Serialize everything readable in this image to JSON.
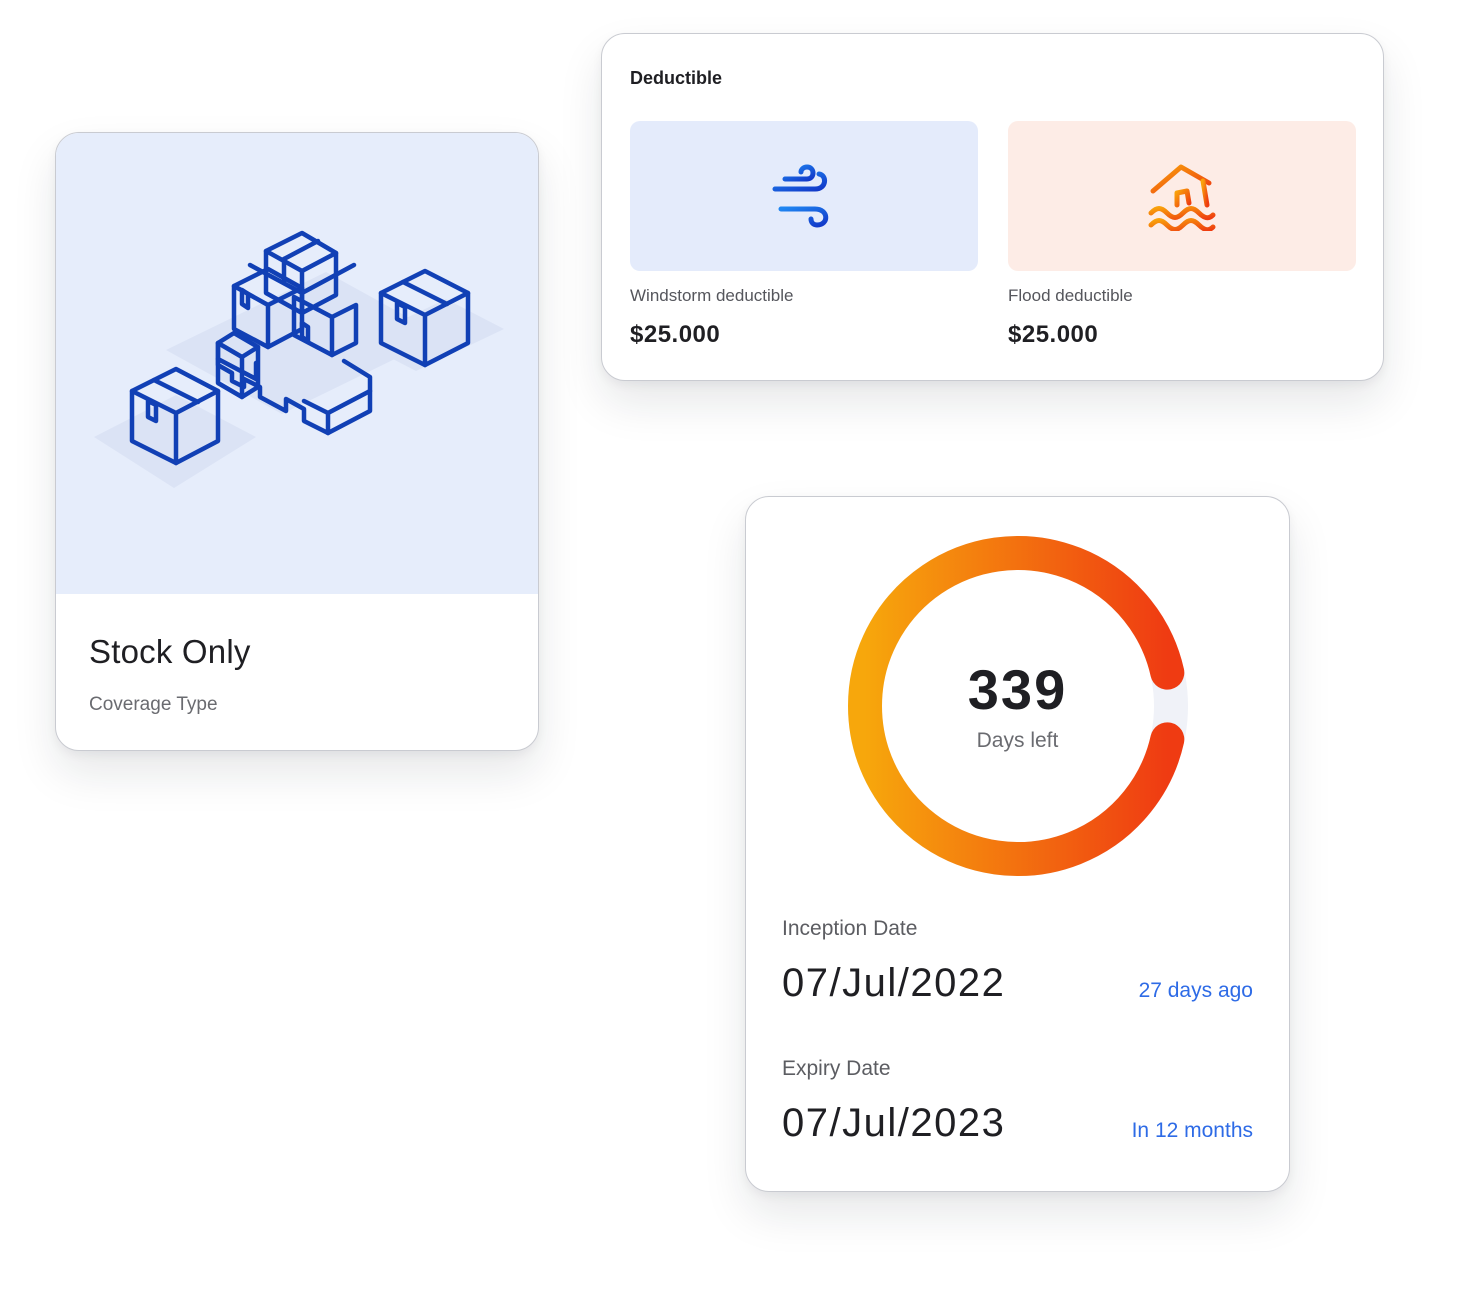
{
  "coverage": {
    "title": "Stock Only",
    "subtitle": "Coverage Type",
    "illustration_icon": "stacked-boxes-icon"
  },
  "deductible": {
    "title": "Deductible",
    "items": [
      {
        "label": "Windstorm deductible",
        "value": "$25.000",
        "icon": "wind-icon",
        "tile_color": "#e4ebfb"
      },
      {
        "label": "Flood deductible",
        "value": "$25.000",
        "icon": "flooded-house-icon",
        "tile_color": "#fdece6"
      }
    ]
  },
  "policy": {
    "days_left": "339",
    "days_left_label": "Days left",
    "inception": {
      "label": "Inception Date",
      "value": "07/Jul/2022",
      "relative": "27 days ago"
    },
    "expiry": {
      "label": "Expiry Date",
      "value": "07/Jul/2023",
      "relative": "In 12 months"
    },
    "progress_fraction": 0.93,
    "accent_color": "#2e6be6",
    "ring_gradient": [
      "#f7a70c",
      "#ef3b12"
    ],
    "ring_track_color": "#f0f2f8"
  }
}
